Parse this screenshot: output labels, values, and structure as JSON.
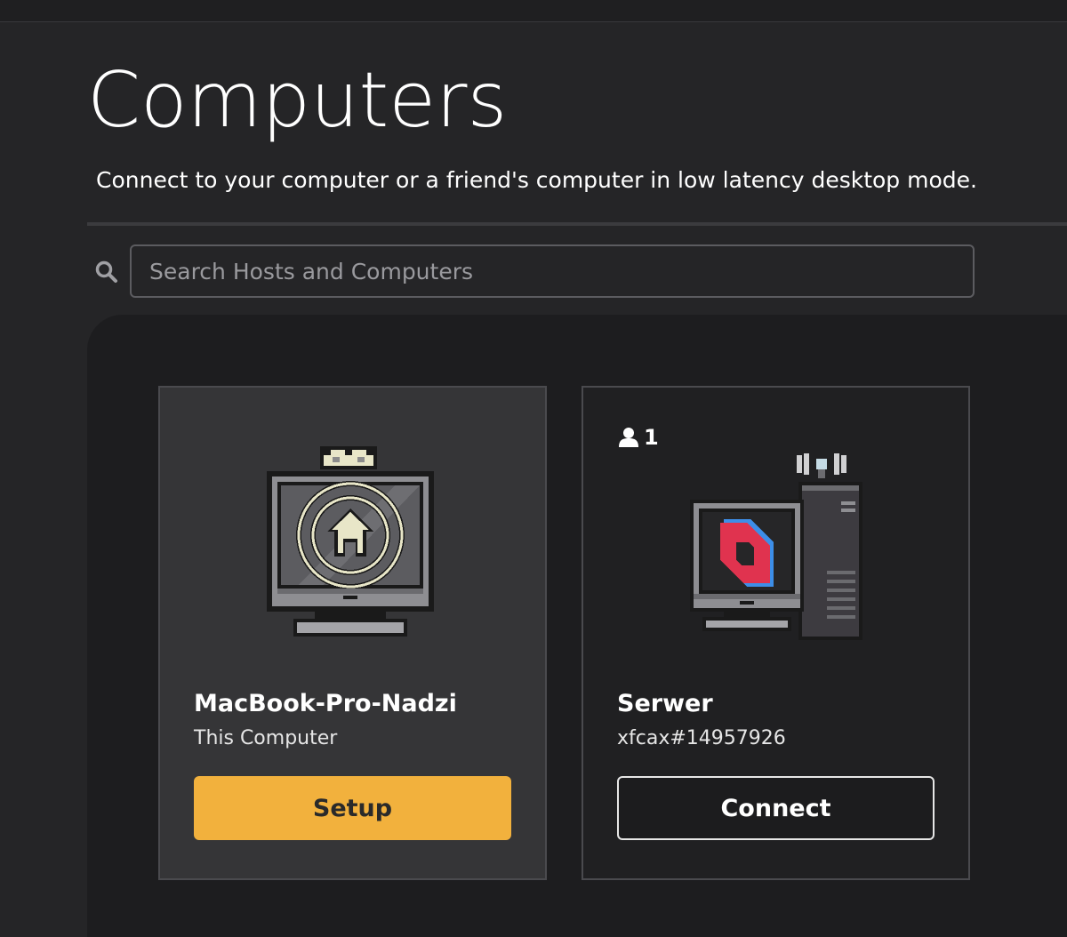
{
  "page": {
    "title": "Computers",
    "subtitle": "Connect to your computer or a friend's computer in low latency desktop mode."
  },
  "search": {
    "placeholder": "Search Hosts and Computers",
    "icon": "search-icon"
  },
  "computers": [
    {
      "name": "MacBook-Pro-Nadzi",
      "detail": "This Computer",
      "action": "Setup",
      "icon": "home-monitor-crown-icon",
      "accent": "#f2b13d"
    },
    {
      "name": "Serwer",
      "detail": "xfcax#14957926",
      "action": "Connect",
      "users": "1",
      "icon": "server-computer-icon"
    }
  ],
  "colors": {
    "background": "#252527",
    "panel": "#1d1d1f",
    "accent": "#f2b13d"
  }
}
